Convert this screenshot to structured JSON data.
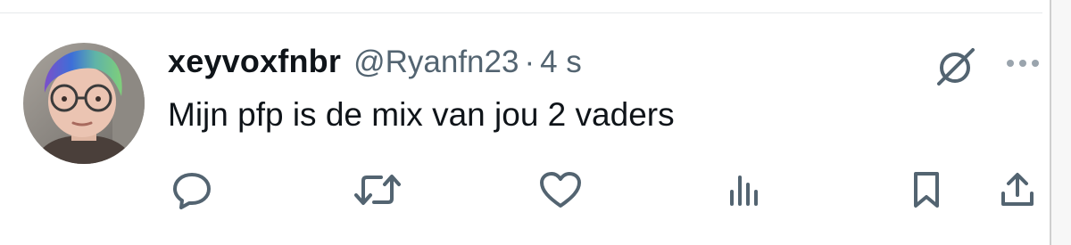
{
  "tweet": {
    "display_name": "xeyvoxfnbr",
    "handle": "@Ryanfn23",
    "separator": "·",
    "time": "4 s",
    "text": "Mijn pfp is de mix van jou 2 vaders"
  },
  "icons": {
    "grok": "grok-icon",
    "more": "more-icon",
    "reply": "reply-icon",
    "retweet": "retweet-icon",
    "like": "like-icon",
    "views": "views-icon",
    "bookmark": "bookmark-icon",
    "share": "share-icon"
  },
  "colors": {
    "text_primary": "#0f1419",
    "text_secondary": "#536471",
    "icon_gray": "#536471",
    "more_gray": "#9aa4ad"
  }
}
